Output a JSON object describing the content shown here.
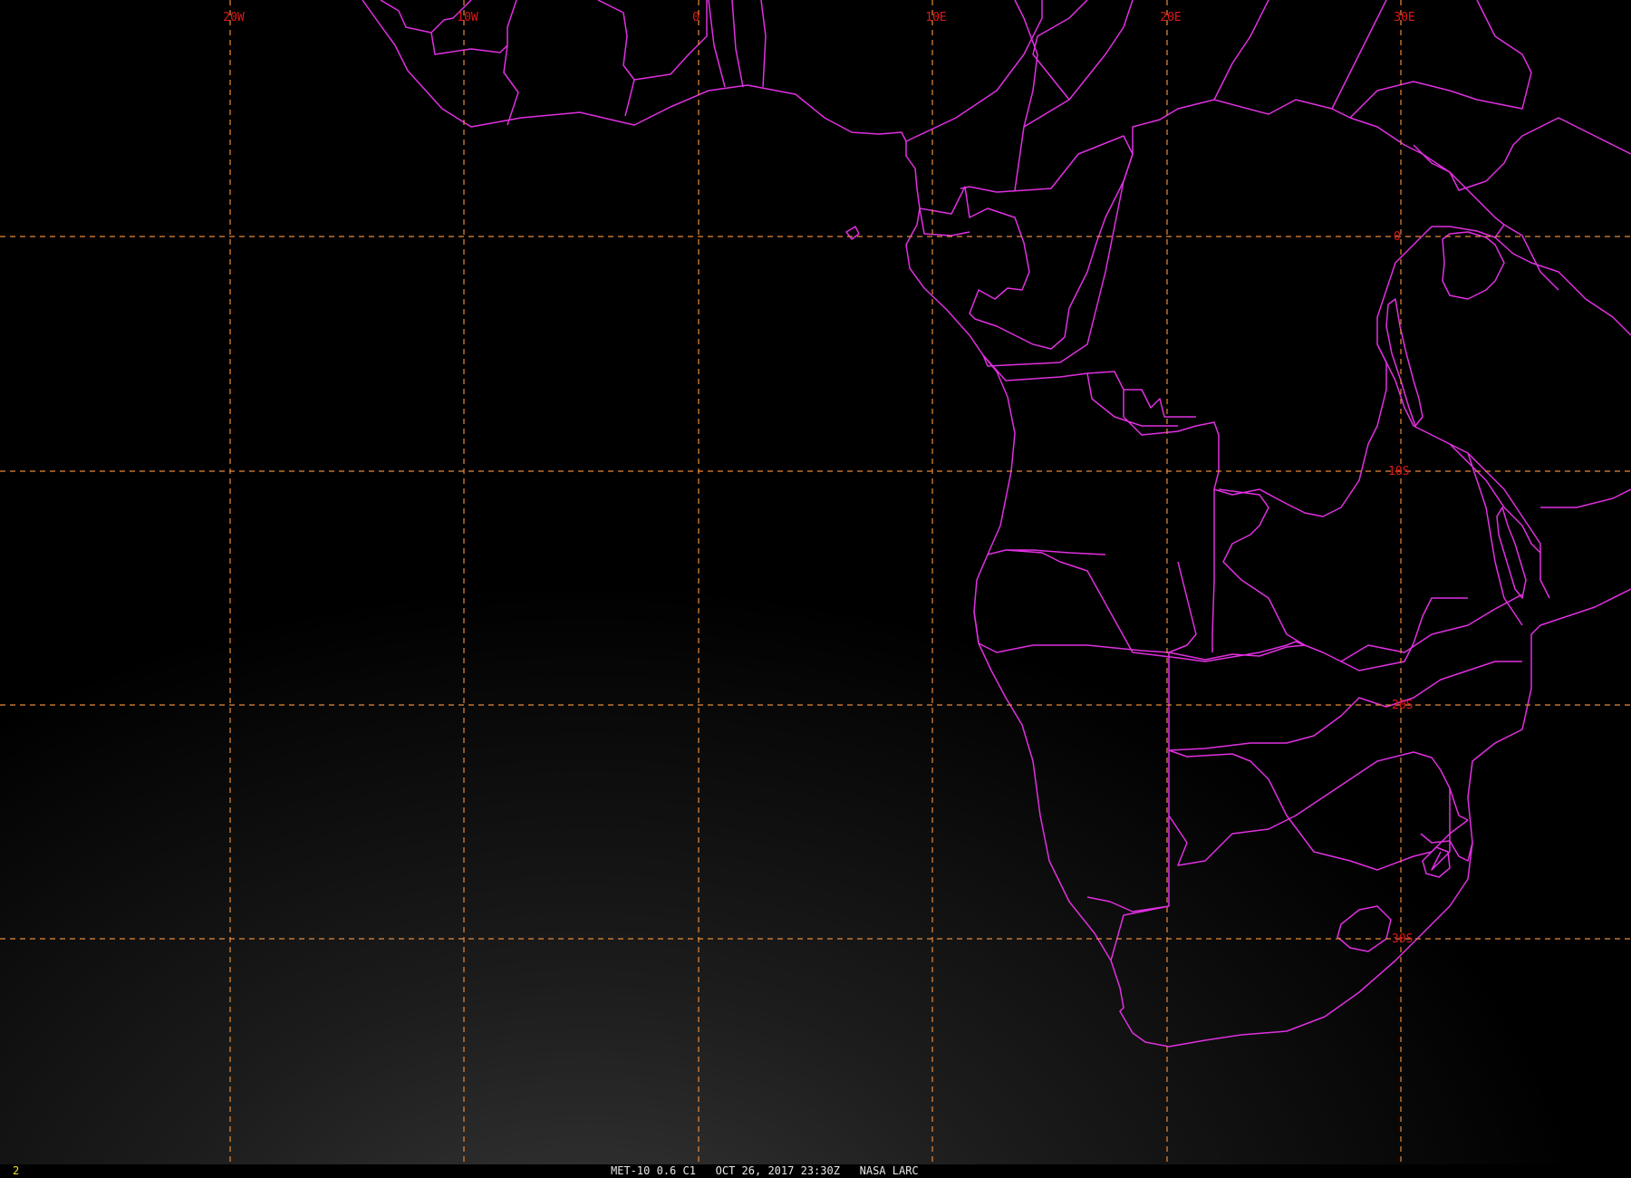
{
  "map": {
    "grid": {
      "lon_labels": [
        "20W",
        "10W",
        "0",
        "10E",
        "20E",
        "30E"
      ],
      "lat_labels": [
        "0",
        "10S",
        "20S",
        "30S"
      ]
    }
  },
  "status_bar": {
    "frame_number": "2",
    "satellite": "MET-10",
    "channel": "0.6 C1",
    "date": "OCT 26, 2017",
    "time": "23:30Z",
    "source": "NASA LARC"
  },
  "colors": {
    "background": "#000000",
    "boundaries": "#e030e0",
    "gridlines": "#e88a3a",
    "grid_labels": "#e01818"
  }
}
